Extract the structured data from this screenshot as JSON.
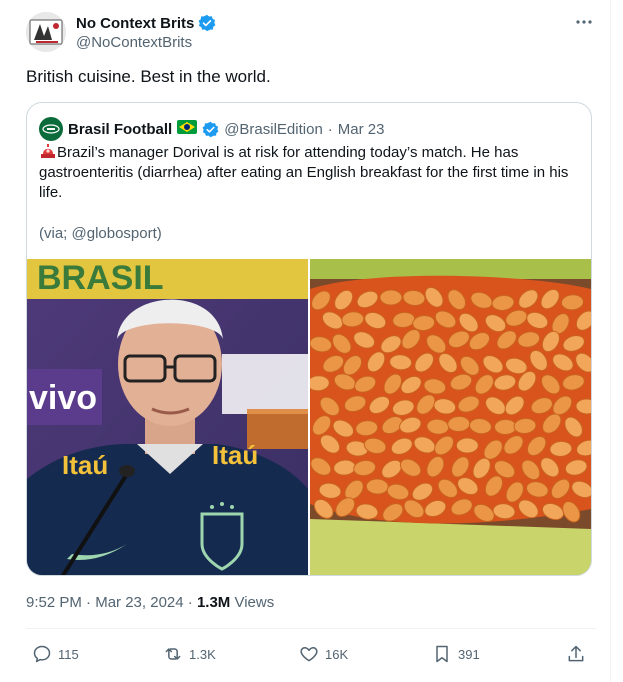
{
  "tweet": {
    "display_name": "No Context Brits",
    "handle": "@NoContextBrits",
    "more_icon": "more-icon",
    "text": "British cuisine. Best in the world."
  },
  "quote": {
    "display_name": "Brasil Football",
    "flag_emoji": "🇧🇷",
    "handle": "@BrasilEdition",
    "separator": "·",
    "date": "Mar 23",
    "alert_emoji": "🚨",
    "body": "Brazil’s manager Dorival is at risk for attending today’s match. He has gastroenteritis (diarrhea) after eating an English breakfast for the first time in his life.",
    "via": "(via; @globosport)",
    "image_left": {
      "sponsor_text_1": "Itaú",
      "sponsor_text_2": "Itaú",
      "backdrop_text": "vivo",
      "banner_text": "BRASIL"
    }
  },
  "stats": {
    "time": "9:52 PM",
    "date": "Mar 23, 2024",
    "views_count": "1.3M",
    "views_label": "Views"
  },
  "actions": {
    "replies": "115",
    "reposts": "1.3K",
    "likes": "16K",
    "bookmarks": "391"
  },
  "colors": {
    "verified": "#1d9bf0",
    "secondary_text": "#536471",
    "primary_text": "#0f1419",
    "border": "#cfd9de"
  }
}
